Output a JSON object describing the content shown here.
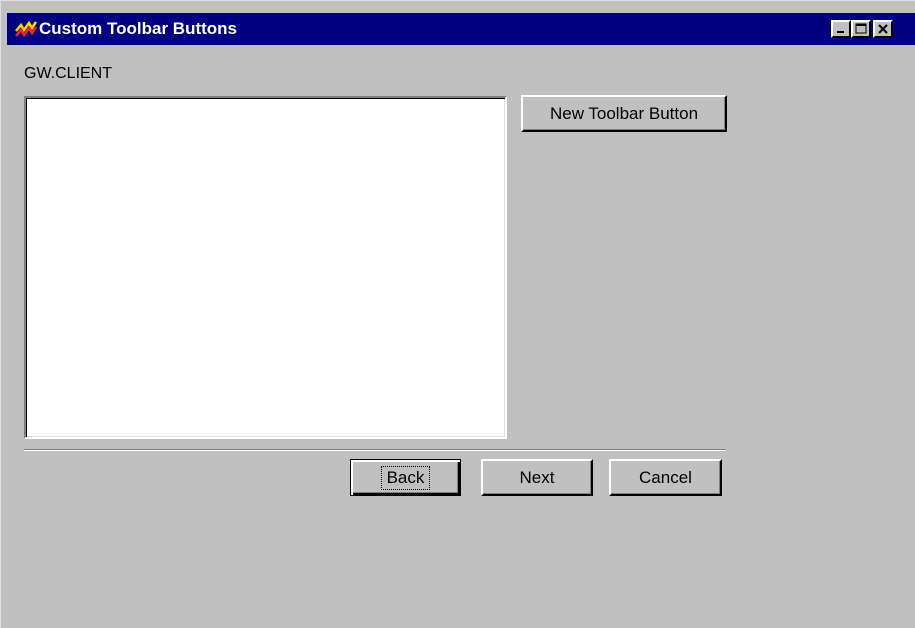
{
  "window": {
    "title": "Custom Toolbar Buttons",
    "icon": "app-zigzag-icon"
  },
  "titlebar_controls": {
    "minimize": "minimize-icon",
    "maximize": "maximize-icon",
    "close": "close-icon"
  },
  "main": {
    "path_label": "GW.CLIENT",
    "new_button_label": "New Toolbar Button",
    "list_items": []
  },
  "footer": {
    "back_label": "Back",
    "next_label": "Next",
    "cancel_label": "Cancel"
  },
  "colors": {
    "titlebar": "#000080",
    "face": "#c0c0c0",
    "list_background": "#ffffff"
  }
}
